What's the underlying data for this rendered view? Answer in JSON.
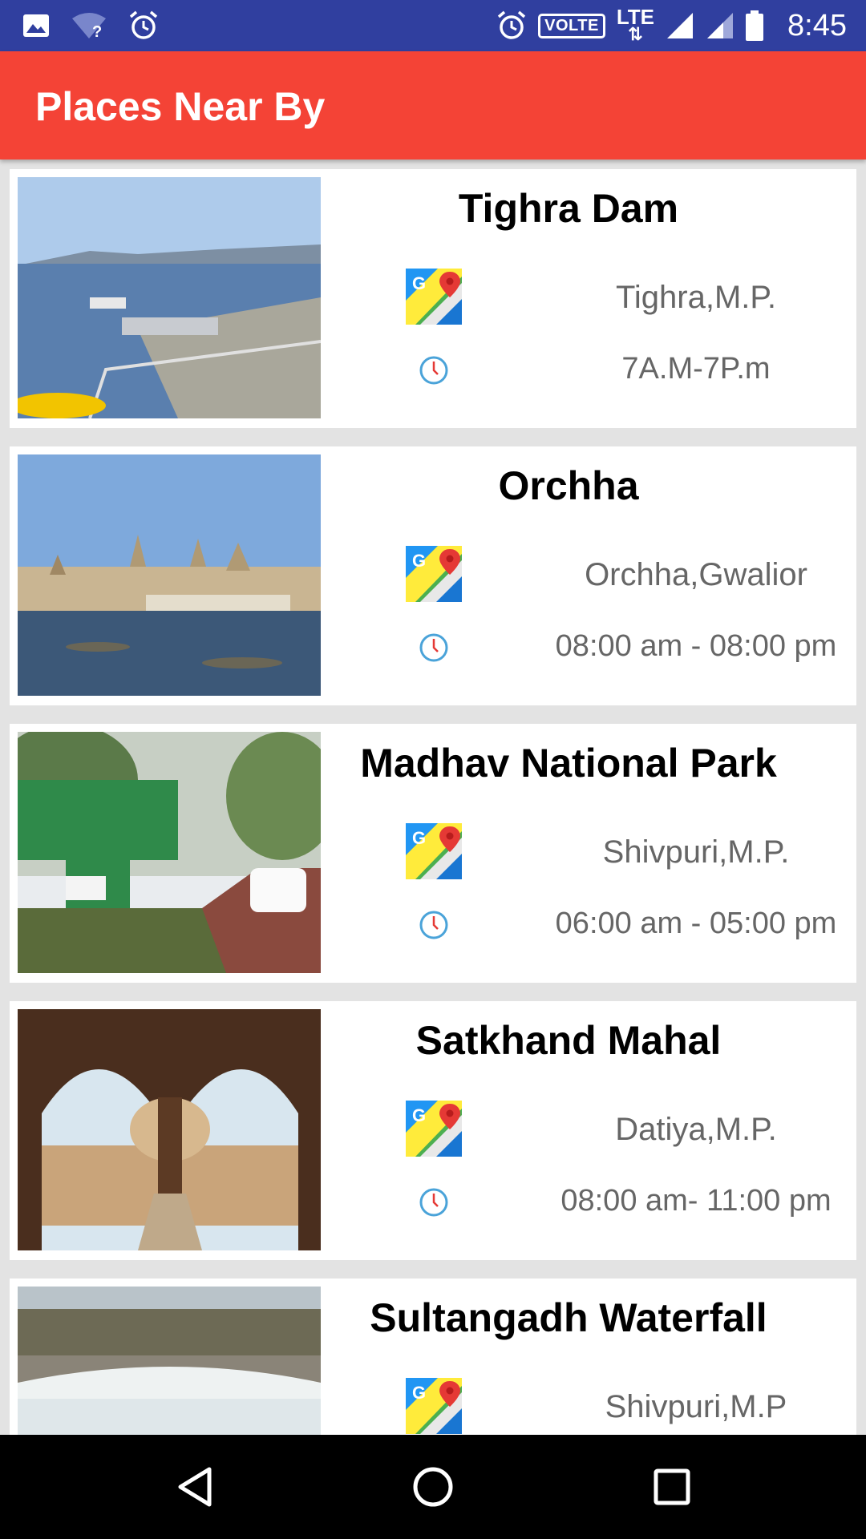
{
  "status_bar": {
    "time": "8:45",
    "volte_label": "VOLTE",
    "lte_label": "LTE",
    "left_icons": [
      "image-icon",
      "wifi-question-icon",
      "alarm-icon"
    ],
    "right_icons": [
      "alarm-icon",
      "volte-badge",
      "lte-icon",
      "signal-icon",
      "signal-icon",
      "battery-icon"
    ]
  },
  "app_bar": {
    "title": "Places Near By",
    "color": "#f44336"
  },
  "places": [
    {
      "name": "Tighra Dam",
      "location": "Tighra,M.P.",
      "hours": "7A.M-7P.m"
    },
    {
      "name": "Orchha",
      "location": "Orchha,Gwalior",
      "hours": "08:00 am - 08:00 pm"
    },
    {
      "name": "Madhav National Park",
      "location": "Shivpuri,M.P.",
      "hours": "06:00 am - 05:00 pm"
    },
    {
      "name": "Satkhand Mahal",
      "location": "Datiya,M.P.",
      "hours": "08:00 am- 11:00 pm"
    },
    {
      "name": "Sultangadh Waterfall",
      "location": "Shivpuri,M.P",
      "hours": ""
    }
  ],
  "nav_bar": {
    "buttons": [
      "back-icon",
      "home-icon",
      "recents-icon"
    ]
  }
}
